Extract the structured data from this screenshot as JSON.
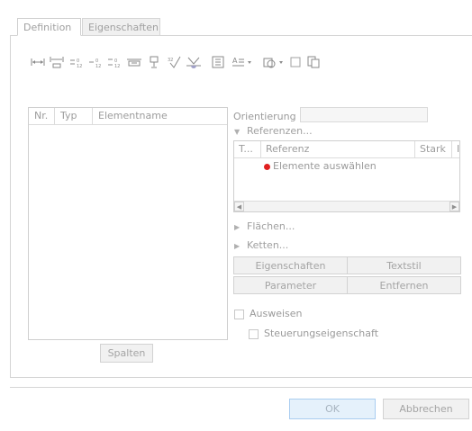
{
  "tabs": [
    {
      "label": "Definition"
    },
    {
      "label": "Eigenschaften"
    }
  ],
  "toolbar": {
    "icons": [
      "dimension-icon",
      "dimension-bracket-icon",
      "tolerance-plus-minus-icon",
      "tolerance-limits-icon",
      "tolerance-stack-icon",
      "basic-dimension-icon",
      "inspection-dimension-icon",
      "surface-finish-icon",
      "weld-symbol-icon",
      "note-icon",
      "text-style-icon",
      "symbol-palette-icon",
      "rectangle-frame-icon",
      "copy-format-icon"
    ]
  },
  "element_list": {
    "columns": [
      "Nr.",
      "Typ",
      "Elementname"
    ],
    "columns_button": "Spalten"
  },
  "orientation": {
    "label": "Orientierung",
    "value": ""
  },
  "references": {
    "header": "Referenzen...",
    "columns": [
      "T...",
      "Referenz",
      "Stark",
      "I"
    ],
    "placeholder": "Elemente auswählen",
    "indicator_color": "#e02020"
  },
  "collapsed_sections": [
    "Flächen...",
    "Ketten..."
  ],
  "action_buttons": {
    "properties": "Eigenschaften",
    "text_style": "Textstil",
    "parameters": "Parameter",
    "remove": "Entfernen"
  },
  "checkboxes": {
    "show": "Ausweisen",
    "control_feature": "Steuerungseigenschaft"
  },
  "footer": {
    "ok": "OK",
    "cancel": "Abbrechen"
  }
}
